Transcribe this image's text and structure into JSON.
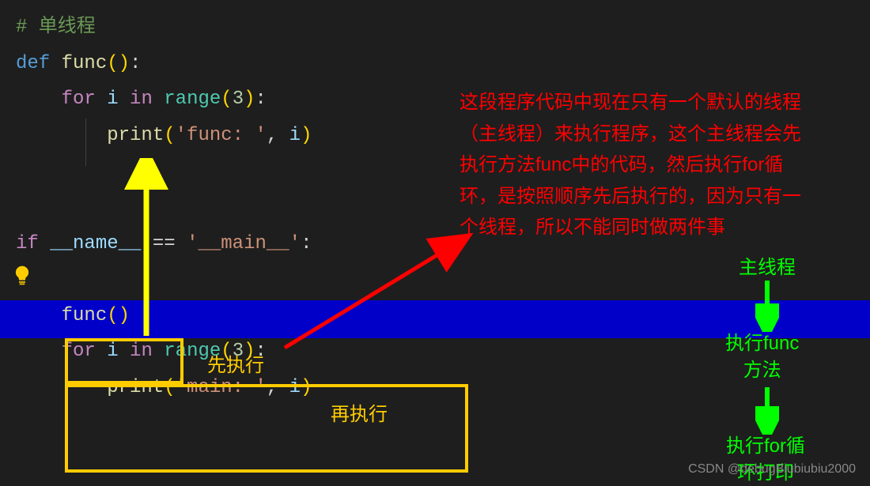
{
  "code": {
    "line1": "# 单线程",
    "line2_def": "def",
    "line2_func": "func",
    "line2_paren": "()",
    "line2_colon": ":",
    "line3_for": "for",
    "line3_i": "i",
    "line3_in": "in",
    "line3_range": "range",
    "line3_num": "3",
    "line4_print": "print",
    "line4_str": "'func: '",
    "line4_i": "i",
    "line7_if": "if",
    "line7_name": "__name__",
    "line7_eq": "==",
    "line7_main": "'__main__'",
    "line7_colon": ":",
    "line9_func": "func",
    "line9_paren": "()",
    "line10_for": "for",
    "line10_i": "i",
    "line10_in": "in",
    "line10_range": "range",
    "line10_num": "3",
    "line11_print": "print",
    "line11_str": "'main: '",
    "line11_i": "i"
  },
  "annotation": {
    "red_line1": "这段程序代码中现在只有一个默认的线程",
    "red_line2": "（主线程）来执行程序，这个主线程会先",
    "red_line3": "执行方法func中的代码，然后执行for循",
    "red_line4": "环，是按照顺序先后执行的，因为只有一",
    "red_line5": "个线程，所以不能同时做两件事",
    "yellow1": "先执行",
    "yellow2": "再执行",
    "green1": "主线程",
    "green2a": "执行func",
    "green2b": "方法",
    "green3a": "执行for循",
    "green3b": "环打印"
  },
  "watermark": "CSDN @debugBiubiubiu2000"
}
